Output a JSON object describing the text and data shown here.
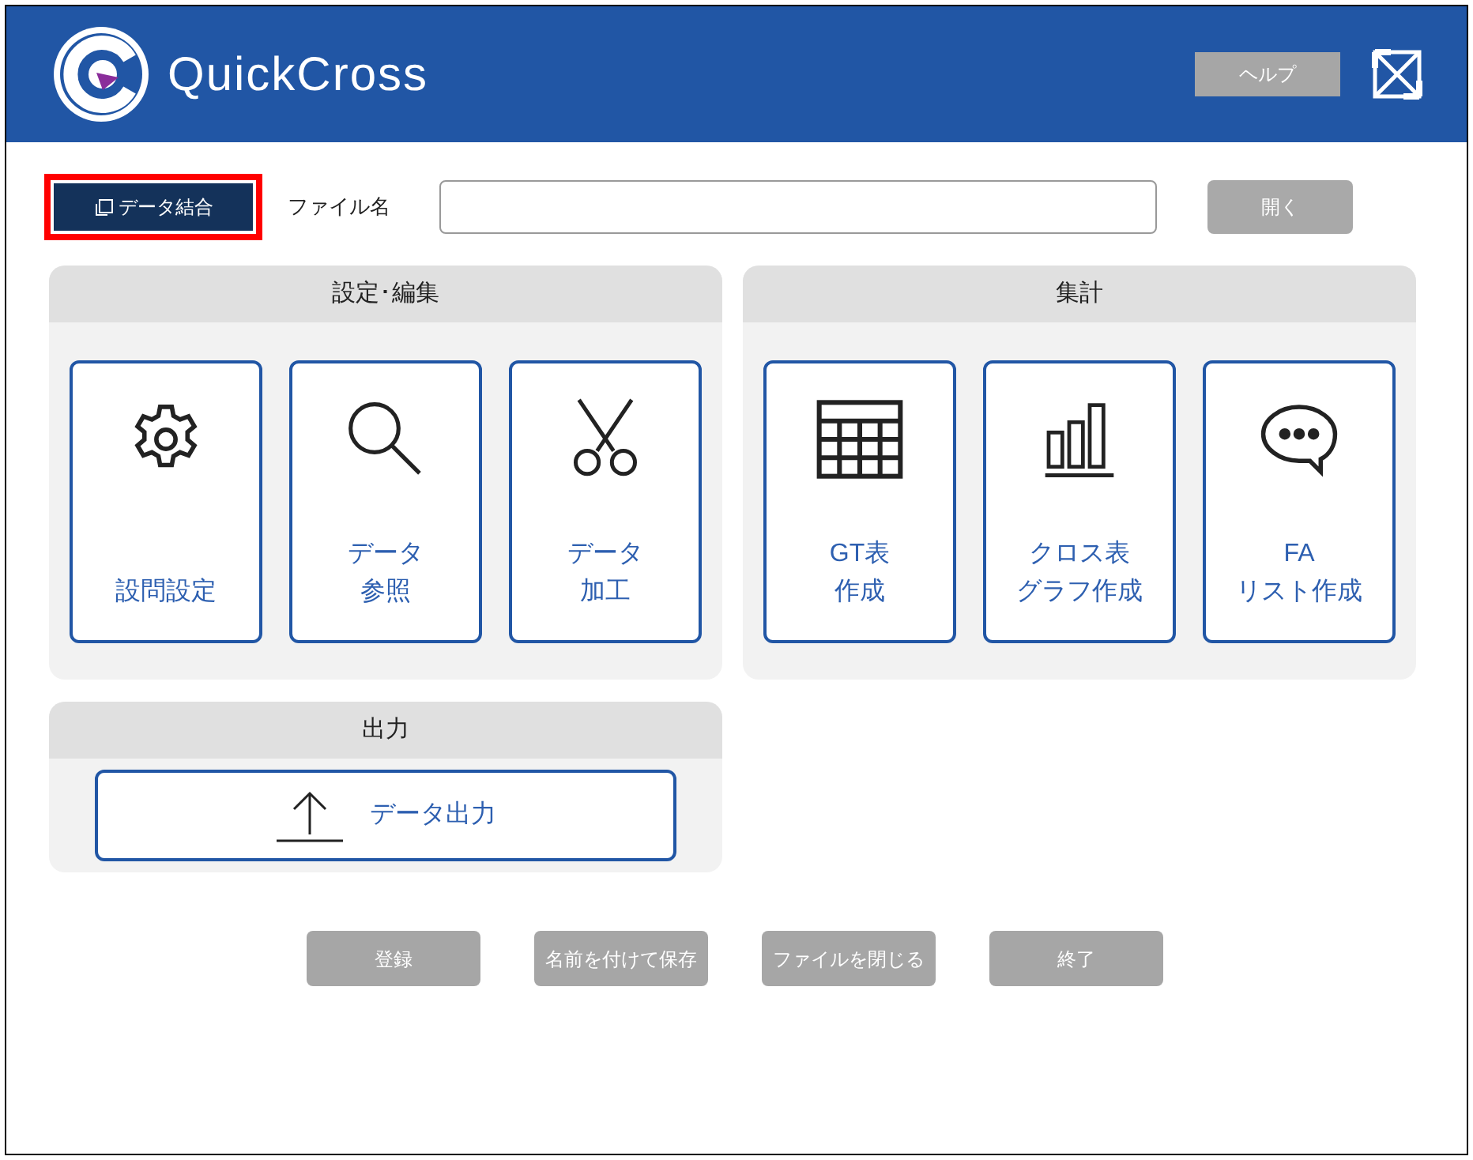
{
  "header": {
    "app_name": "QuickCross",
    "help_button": {
      "label": "ヘルプ",
      "disabled": true
    }
  },
  "file_bar": {
    "merge_button": {
      "label": "データ結合",
      "highlighted": true
    },
    "file_label": "ファイル名",
    "open_button": {
      "label": "開く",
      "disabled": true
    }
  },
  "sections": [
    {
      "title": "設定･編集",
      "tiles": [
        {
          "lines": [
            "設問設定"
          ]
        },
        {
          "lines": [
            "データ",
            "参照"
          ]
        },
        {
          "lines": [
            "データ",
            "加工"
          ]
        }
      ]
    },
    {
      "title": "集計",
      "tiles": [
        {
          "lines": [
            "GT表",
            "作成"
          ]
        },
        {
          "lines": [
            "クロス表",
            "グラフ作成"
          ]
        },
        {
          "lines": [
            "FA",
            "リスト作成"
          ]
        }
      ]
    }
  ],
  "output": {
    "title": "出力",
    "button": "データ出力"
  },
  "footer_buttons": [
    {
      "label": "登録",
      "disabled": true
    },
    {
      "label": "名前を付けて保存",
      "disabled": true
    },
    {
      "label": "ファイルを閉じる",
      "disabled": true
    },
    {
      "label": "終了",
      "disabled": true
    }
  ]
}
